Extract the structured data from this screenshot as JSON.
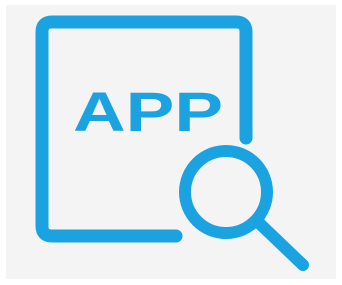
{
  "icon": {
    "label": "APP",
    "name": "app-search-icon",
    "colors": {
      "stroke": "#1aa3e0",
      "panel": "#f4f4f4",
      "background": "#ffffff"
    }
  }
}
